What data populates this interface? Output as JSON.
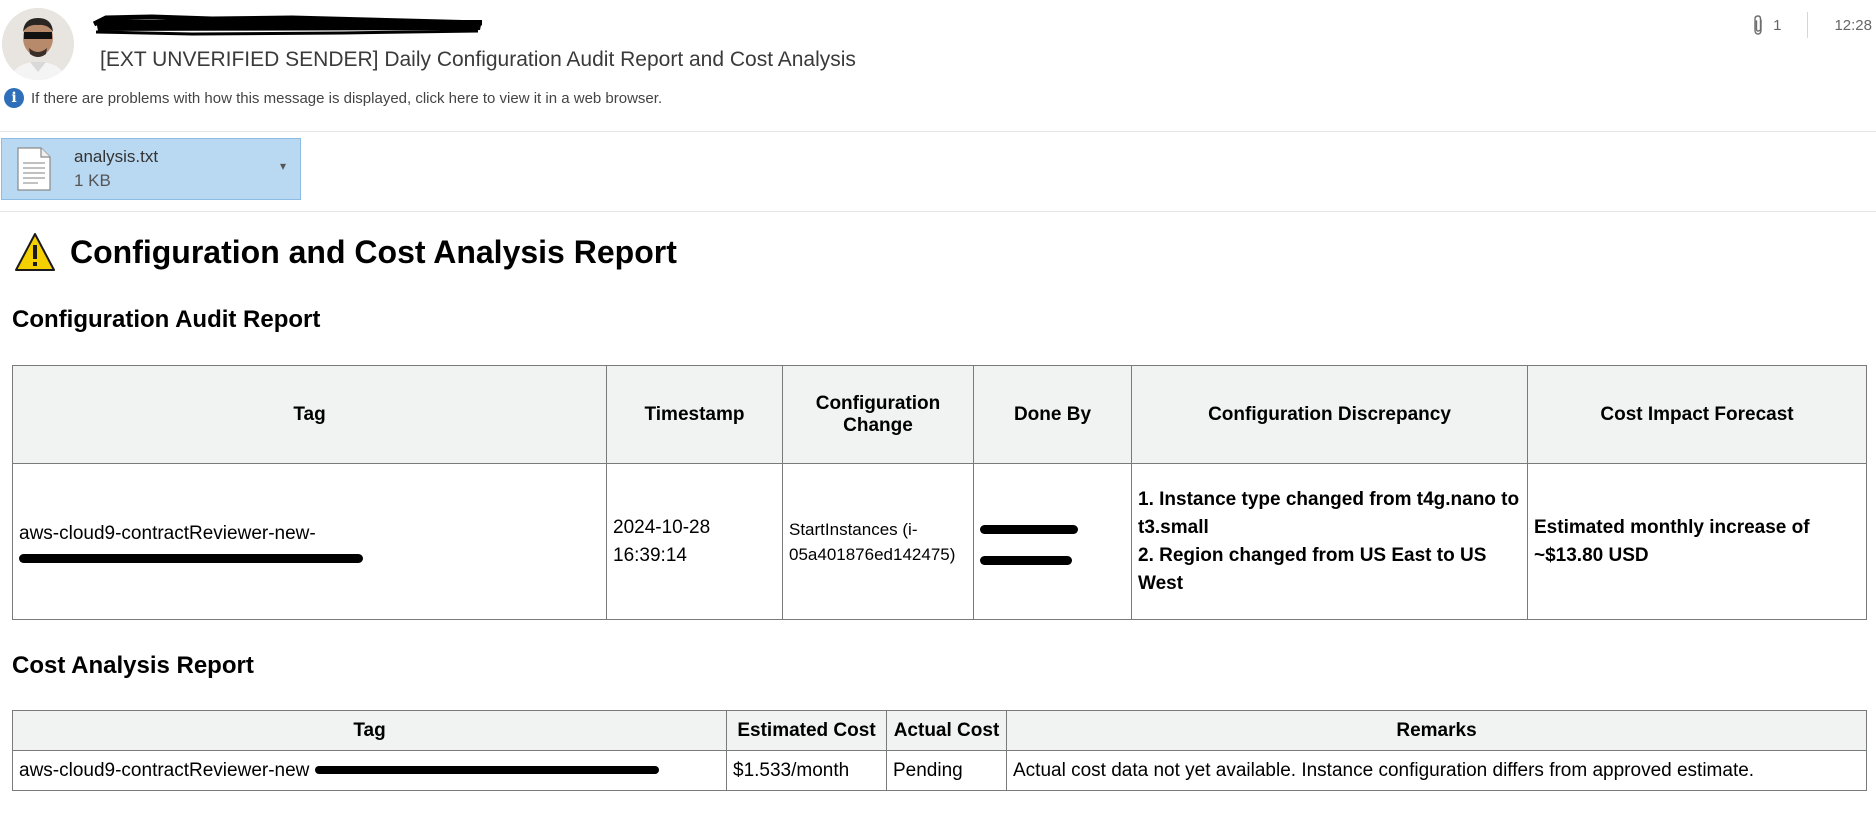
{
  "header": {
    "subject": "[EXT UNVERIFIED SENDER] Daily Configuration Audit Report and Cost Analysis",
    "info_message": "If there are problems with how this message is displayed, click here to view it in a web browser.",
    "attachment_count": "1",
    "time": "12:28"
  },
  "attachment": {
    "filename": "analysis.txt",
    "size": "1 KB"
  },
  "report": {
    "title": "Configuration and Cost Analysis Report",
    "audit": {
      "heading": "Configuration Audit Report",
      "columns": [
        "Tag",
        "Timestamp",
        "Configuration Change",
        "Done By",
        "Configuration Discrepancy",
        "Cost Impact Forecast"
      ],
      "row": {
        "tag": "aws-cloud9-contractReviewer-new-",
        "timestamp": "2024-10-28 16:39:14",
        "change": "StartInstances (i-05a401876ed142475)",
        "discrepancy": [
          "1. Instance type changed from t4g.nano to t3.small",
          "2. Region changed from US East to US West"
        ],
        "forecast": "Estimated monthly increase of ~$13.80 USD"
      }
    },
    "cost": {
      "heading": "Cost Analysis Report",
      "columns": [
        "Tag",
        "Estimated Cost",
        "Actual Cost",
        "Remarks"
      ],
      "row": {
        "tag": "aws-cloud9-contractReviewer-new",
        "estimated": "$1.533/month",
        "actual": "Pending",
        "remarks": "Actual cost data not yet available. Instance configuration differs from approved estimate."
      }
    }
  },
  "colors": {
    "attachment_bg": "#b9d8f1",
    "info_icon": "#2f6fba",
    "warning": "#f5d000",
    "table_header_bg": "#f1f2f2"
  },
  "icons": {
    "info": "info-icon",
    "attachment": "paperclip-icon",
    "file": "text-file-icon",
    "warning": "warning-icon"
  }
}
